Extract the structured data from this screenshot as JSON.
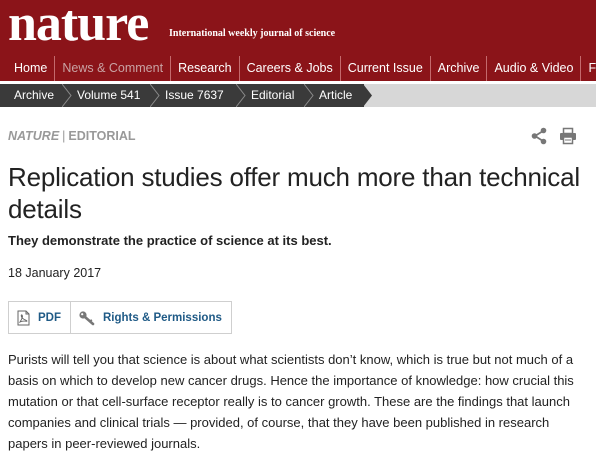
{
  "masthead": {
    "logo": "nature",
    "tagline": "International weekly journal of science"
  },
  "topnav": {
    "items": [
      {
        "label": "Home"
      },
      {
        "label": "News & Comment"
      },
      {
        "label": "Research"
      },
      {
        "label": "Careers & Jobs"
      },
      {
        "label": "Current Issue"
      },
      {
        "label": "Archive"
      },
      {
        "label": "Audio & Video"
      },
      {
        "label": "For A"
      }
    ]
  },
  "breadcrumb": {
    "items": [
      {
        "label": "Archive"
      },
      {
        "label": "Volume 541"
      },
      {
        "label": "Issue 7637"
      },
      {
        "label": "Editorial"
      },
      {
        "label": "Article"
      }
    ]
  },
  "article": {
    "journal": "NATURE",
    "separator": "|",
    "section": "EDITORIAL",
    "title": "Replication studies offer much more than technical details",
    "standfirst": "They demonstrate the practice of science at its best.",
    "date": "18 January 2017",
    "tools": {
      "pdf_label": "PDF",
      "rights_label": "Rights & Permissions"
    },
    "body": "Purists will tell you that science is about what scientists don’t know, which is true but not much of a basis on which to develop new cancer drugs. Hence the importance of knowledge: how crucial this mutation or that cell-surface receptor really is to cancer growth. These are the findings that launch companies and clinical trials — provided, of course, that they have been published in research papers in peer-reviewed journals."
  },
  "icons": {
    "share": "share-icon",
    "print": "print-icon",
    "pdf": "pdf-icon",
    "rights": "key-icon"
  },
  "colors": {
    "brand": "#8b1419",
    "breadcrumb_dark": "#3a3a3a",
    "link": "#1f5a86"
  }
}
